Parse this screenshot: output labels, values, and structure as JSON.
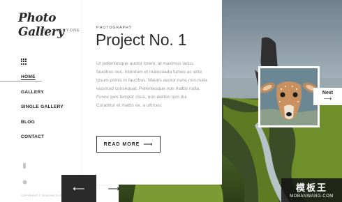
{
  "brand": {
    "logo": "Photo Gallery",
    "tagline": "FOR EVERYONE"
  },
  "nav": {
    "items": [
      {
        "label": "HOME",
        "active": true
      },
      {
        "label": "GALLERY"
      },
      {
        "label": "SINGLE GALLERY"
      },
      {
        "label": "BLOG"
      },
      {
        "label": "CONTACT"
      }
    ]
  },
  "icons": {
    "menu": "grid-icon",
    "social_1": "social-icon",
    "social_2": "social-icon",
    "prev": "arrow-left-icon",
    "next": "arrow-right-icon"
  },
  "footer": {
    "copyright": "COPYRIGHT © 2016 PHOTO GALLERY"
  },
  "content": {
    "kicker": "PHOTOGRAPHY",
    "title": "Project No. 1",
    "body": "Ut pellentesque auctor lorem, at maximus lacus faucibus nec. Interdum et malesuada fames ac ante ipsum primis in faucibus. Mauris auctor nunc non nulla euismod consequat. Pellentesque non mattis nulla. Fusce quis tempor risus, non eleifen tum dui. Curabitur et mattis ex, a ultrices.",
    "read_more": "READ MORE",
    "read_more_arrow": "⟶"
  },
  "pager": {
    "prev": "⟵",
    "next": "⟶"
  },
  "next_panel": {
    "label": "Next",
    "arrow": "⟶"
  },
  "watermark": {
    "text": "模板王",
    "url": "MOBANWANG.COM"
  },
  "colors": {
    "accent_dark": "#2b2b2b",
    "text_muted": "#999999",
    "sky": "#8fa4b2",
    "grass": "#6c8a2e"
  }
}
